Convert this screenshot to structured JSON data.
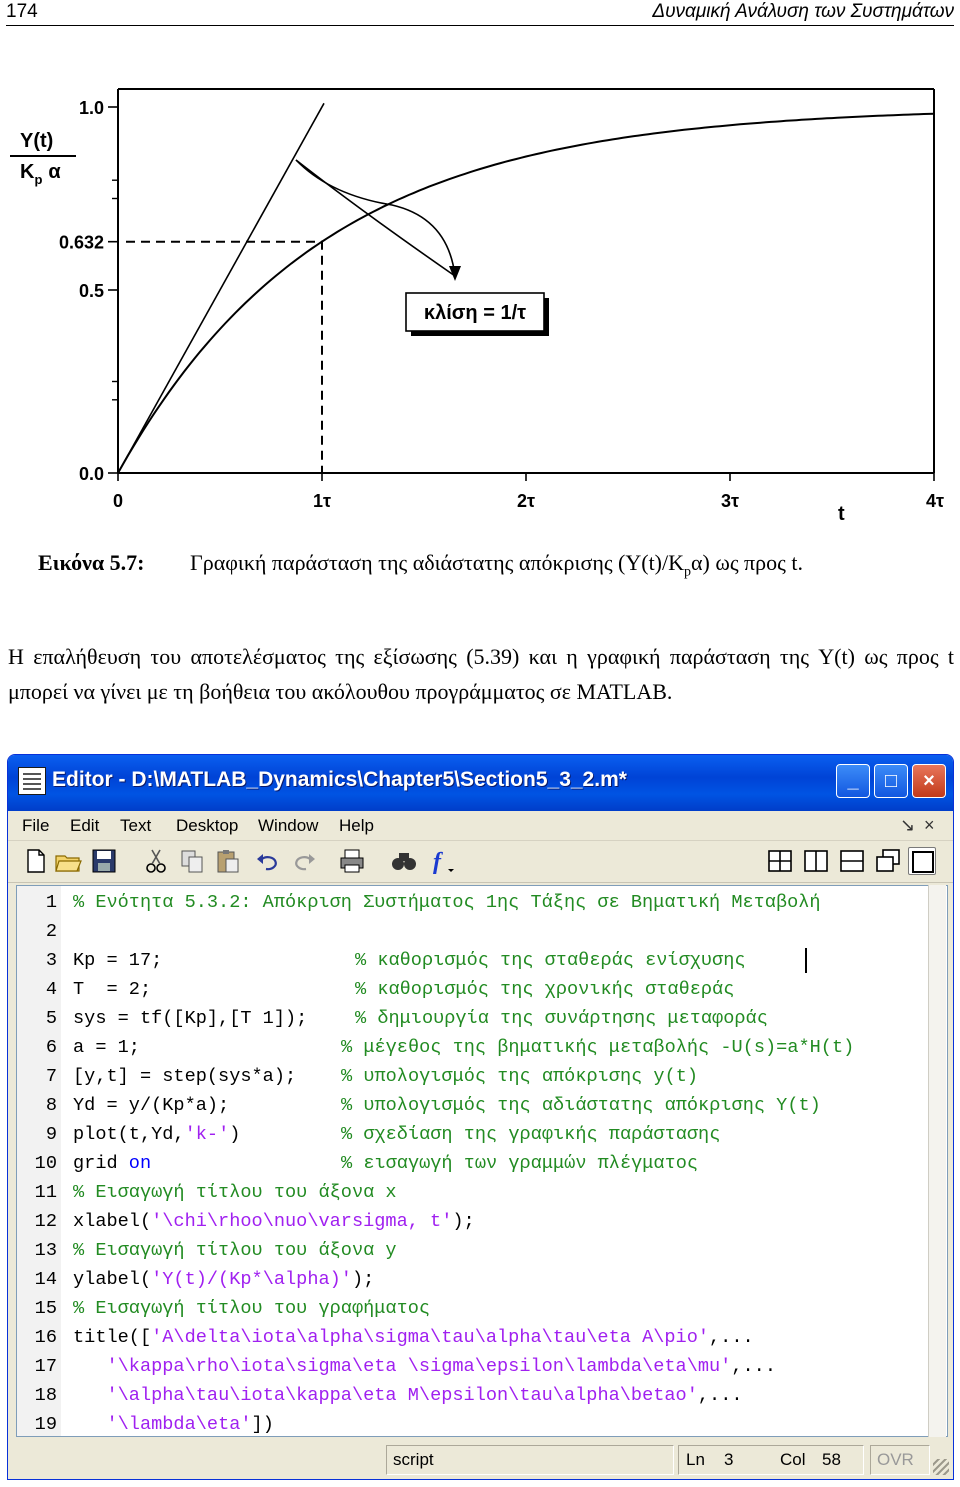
{
  "header": {
    "page_number": "174",
    "running_title": "Δυναμική Ανάλυση των Συστημάτων"
  },
  "figure": {
    "y_label_top": "Y(t)",
    "y_label_bottom_K": "K",
    "y_label_bottom_sub": "p",
    "y_label_bottom_alpha": "α",
    "y_ticks": [
      "1.0",
      "0.632",
      "0.5",
      "0.0"
    ],
    "x_ticks": [
      "0",
      "1τ",
      "2τ",
      "3τ",
      "4τ"
    ],
    "x_axis_label": "t",
    "slope_box": "κλίση = 1/τ"
  },
  "chart_data": {
    "type": "line",
    "title": "",
    "xlabel": "t",
    "ylabel": "Y(t)/Kpα",
    "xlim": [
      0,
      4
    ],
    "ylim": [
      0,
      1
    ],
    "x_ticks": [
      "0",
      "1τ",
      "2τ",
      "3τ",
      "4τ"
    ],
    "y_ticks": [
      1.0,
      0.632,
      0.5,
      0.0
    ],
    "series": [
      {
        "x": [
          0,
          0.25,
          0.5,
          0.75,
          1,
          1.25,
          1.5,
          1.75,
          2,
          2.5,
          3,
          3.5,
          4
        ],
        "values": [
          0,
          0.221,
          0.393,
          0.528,
          0.632,
          0.713,
          0.777,
          0.826,
          0.865,
          0.918,
          0.95,
          0.97,
          0.982
        ]
      },
      {
        "x": [
          0,
          1
        ],
        "values": [
          0,
          1
        ]
      }
    ],
    "annotations": [
      "κλίση = 1/τ",
      "0.632"
    ],
    "grid": false
  },
  "caption": {
    "label": "Εικόνα 5.7:",
    "text_before": "Γραφική παράσταση της αδιάστατης απόκρισης (Y(t)/K",
    "sub": "p",
    "text_after": "α) ως προς t."
  },
  "paragraph": "Η επαλήθευση του αποτελέσματος της εξίσωσης (5.39) και η γραφική παράσταση της Y(t) ως προς t μπορεί να γίνει με τη βοήθεια του ακόλουθου προγράμματος σε MATLAB.",
  "editor": {
    "window_title": "Editor - D:\\MATLAB_Dynamics\\Chapter5\\Section5_3_2.m*",
    "window_buttons": [
      "_",
      "□",
      "×"
    ],
    "menus": [
      "File",
      "Edit",
      "Text",
      "Desktop",
      "Window",
      "Help"
    ],
    "menu_right": [
      "↘",
      "×"
    ],
    "toolbar_icons": [
      "new-file-icon",
      "open-folder-icon",
      "save-icon",
      "cut-icon",
      "copy-icon",
      "paste-icon",
      "undo-icon",
      "redo-icon",
      "print-icon",
      "find-icon",
      "function-icon",
      "tile-icon",
      "split-vertical-icon",
      "split-horizontal-icon",
      "float-icon",
      "maximize-doc-icon"
    ],
    "function_glyph": "f",
    "lines": [
      {
        "n": "1",
        "code": "",
        "comment": "% Ενότητα 5.3.2: Απόκριση Συστήματος 1ης Τάξης σε Βηματική Μεταβολή"
      },
      {
        "n": "2",
        "code": "",
        "comment": ""
      },
      {
        "n": "3",
        "code": "Kp = 17;",
        "comment": "% καθορισμός της σταθεράς ενίσχυσης"
      },
      {
        "n": "4",
        "code": "T  = 2;",
        "comment": "% καθορισμός της χρονικής σταθεράς"
      },
      {
        "n": "5",
        "code": "sys = tf([Kp],[T 1]);",
        "comment": "% δημιουργία της συνάρτησης μεταφοράς"
      },
      {
        "n": "6",
        "code": "a = 1;",
        "comment": "% μέγεθος της βηματικής μεταβολής -U(s)=a*H(t)"
      },
      {
        "n": "7",
        "code": "[y,t] = step(sys*a);",
        "comment": "% υπολογισμός της απόκρισης y(t)"
      },
      {
        "n": "8",
        "code": "Yd = y/(Kp*a);",
        "comment": "% υπολογισμός της αδιάστατης απόκρισης Y(t)"
      },
      {
        "n": "9",
        "code_a": "plot(t,Yd,",
        "str": "'k-'",
        "code_b": ")",
        "comment": "% σχεδίαση της γραφικής παράστασης"
      },
      {
        "n": "10",
        "code_a": "grid ",
        "kw": "on",
        "comment": "% εισαγωγή των γραμμών πλέγματος"
      },
      {
        "n": "11",
        "code": "",
        "comment": "% Εισαγωγή τίτλου του άξονα x"
      },
      {
        "n": "12",
        "code_a": "xlabel(",
        "str": "'\\chi\\rhoo\\nuo\\varsigma, t'",
        "code_b": ");"
      },
      {
        "n": "13",
        "code": "",
        "comment": "% Εισαγωγή τίτλου του άξονα y"
      },
      {
        "n": "14",
        "code_a": "ylabel(",
        "str": "'Y(t)/(Kp*\\alpha)'",
        "code_b": ");"
      },
      {
        "n": "15",
        "code": "",
        "comment": "% Εισαγωγή τίτλου του γραφήματος"
      },
      {
        "n": "16",
        "code_a": "title([",
        "str": "'A\\delta\\iota\\alpha\\sigma\\tau\\alpha\\tau\\eta A\\pio'",
        "code_b": ",..."
      },
      {
        "n": "17",
        "code_a": "   ",
        "str": "'\\kappa\\rho\\iota\\sigma\\eta \\sigma\\epsilon\\lambda\\eta\\mu'",
        "code_b": ",..."
      },
      {
        "n": "18",
        "code_a": "   ",
        "str": "'\\alpha\\tau\\iota\\kappa\\eta M\\epsilon\\tau\\alpha\\betao'",
        "code_b": ",..."
      },
      {
        "n": "19",
        "code_a": "   ",
        "str": "'\\lambda\\eta'",
        "code_b": "])"
      }
    ],
    "status": {
      "mode": "script",
      "ln_label": "Ln",
      "ln": "3",
      "col_label": "Col",
      "col": "58",
      "ovr": "OVR"
    }
  }
}
